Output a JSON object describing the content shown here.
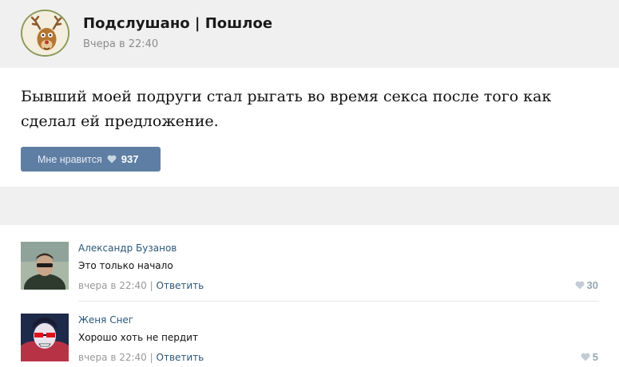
{
  "post": {
    "group_name": "Подслушано | Пошлое",
    "time": "Вчера в 22:40",
    "text": "Бывший моей подруги стал рыгать во время секса после того как сделал ей предложение.",
    "like_label": "Мне нравится",
    "like_count": "937"
  },
  "comments": [
    {
      "author": "Александр Бузанов",
      "text": "Это только начало",
      "time": "вчера в 22:40",
      "separator": "|",
      "reply": "Ответить",
      "likes": "30"
    },
    {
      "author": "Женя Снег",
      "text": "Хорошо хоть не пердит",
      "time": "вчера в 22:40",
      "separator": "|",
      "reply": "Ответить",
      "likes": "5"
    }
  ],
  "colors": {
    "like_button": "#5f7ea3",
    "link": "#2b587a",
    "header_bg": "#f0f0f0"
  },
  "icons": [
    "heart-icon",
    "deer-logo"
  ]
}
